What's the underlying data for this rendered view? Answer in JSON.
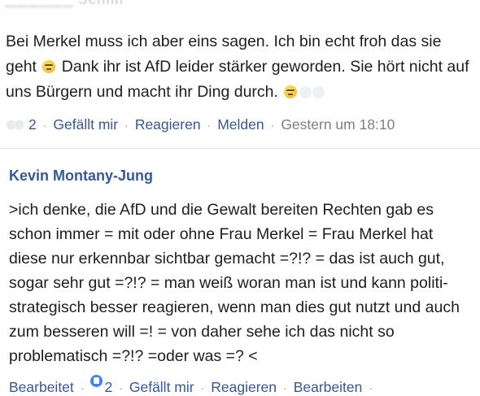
{
  "comment1": {
    "author_partial": "Schmi",
    "text_part1": "Bei Merkel  muss ich aber eins sagen. Ich bin echt froh das sie geht ",
    "text_part2": " Dank ihr ist AfD leider stärker geworden. Sie hört nicht auf uns Bürgern und macht ihr Ding durch. ",
    "emoji_icon": "unamused-face-icon",
    "actions": {
      "like_count": "2",
      "like": "Gefällt mir",
      "react": "Reagieren",
      "report": "Melden",
      "timestamp": "Gestern um 18:10"
    }
  },
  "comment2": {
    "author": "Kevin Montany-Jung",
    "text": ">ich denke, die AfD und die Gewalt bereiten Rechten gab es schon immer = mit oder ohne Frau Merkel = Frau Merkel hat diese nur erkennbar sichtbar gemacht =?!? = das ist auch gut, sogar sehr gut =?!? = man weiß woran man ist und kann politi-strategisch besser reagieren, wenn man dies gut nutzt und auch zum besseren will =! = von daher sehe ich das nicht so problematisch =?!? =oder was =? <",
    "actions": {
      "edited": "Bearbeitet",
      "like_count": "2",
      "like": "Gefällt mir",
      "react": "Reagieren",
      "edit": "Bearbeiten"
    }
  },
  "separator": "·",
  "colors": {
    "link": "#365899",
    "text": "#1c1e21",
    "muted": "#7f7f7f",
    "like_badge": "#4080ff"
  }
}
